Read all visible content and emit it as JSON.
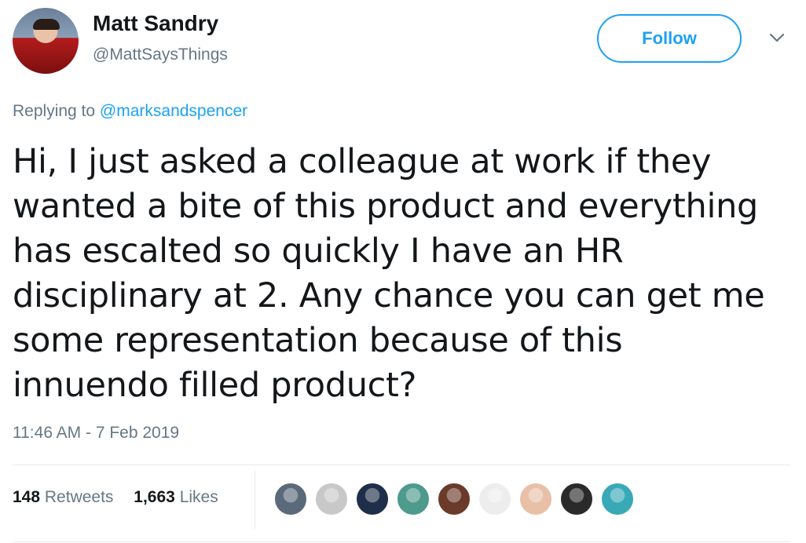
{
  "author": {
    "name": "Matt Sandry",
    "handle": "@MattSaysThings"
  },
  "follow_button": {
    "label": "Follow"
  },
  "reply": {
    "prefix": "Replying to",
    "mention": "@marksandspencer"
  },
  "tweet": {
    "lines": [
      "Hi, I just asked a colleague at work if they",
      "wanted a bite of this product and everything",
      "has escalted so quickly I have an HR",
      "disciplinary at 2. Any chance you can get me",
      "some representation because of this",
      "innuendo filled product?"
    ],
    "timestamp": "11:46 AM - 7 Feb 2019"
  },
  "stats": {
    "retweets_count": "148",
    "retweets_label": "Retweets",
    "likes_count": "1,663",
    "likes_label": "Likes"
  },
  "likers": [
    {
      "icon": "liker-avatar-1",
      "color": "#5a6a7a"
    },
    {
      "icon": "liker-avatar-2",
      "color": "#c8c8c8"
    },
    {
      "icon": "liker-avatar-3",
      "color": "#1f2f4a"
    },
    {
      "icon": "liker-avatar-4",
      "color": "#4e9a8c"
    },
    {
      "icon": "liker-avatar-5",
      "color": "#6a3a2a"
    },
    {
      "icon": "liker-avatar-6",
      "color": "#ededed"
    },
    {
      "icon": "liker-avatar-7",
      "color": "#e8c0a8"
    },
    {
      "icon": "liker-avatar-8",
      "color": "#2a2a2a"
    },
    {
      "icon": "liker-avatar-9",
      "color": "#39a9b8"
    }
  ],
  "colors": {
    "accent": "#1da1f2",
    "secondary_text": "#657786",
    "primary_text": "#14171a",
    "divider": "#e6ecf0"
  }
}
